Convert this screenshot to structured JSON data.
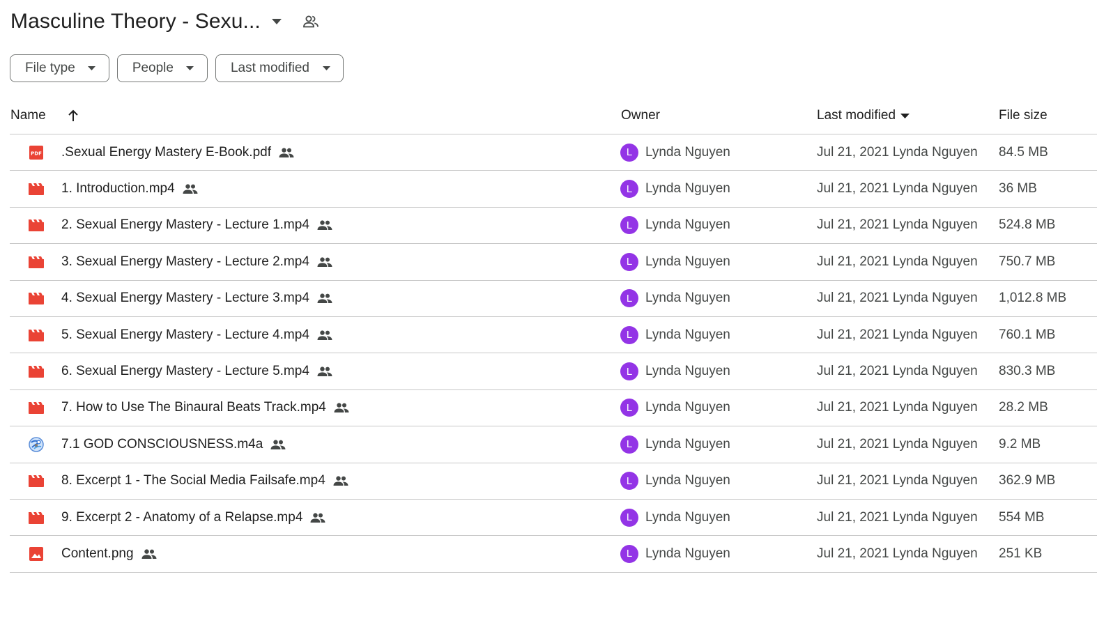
{
  "folder": {
    "title": "Masculine Theory - Sexu..."
  },
  "filters": [
    {
      "label": "File type"
    },
    {
      "label": "People"
    },
    {
      "label": "Last modified"
    }
  ],
  "columns": {
    "name": "Name",
    "owner": "Owner",
    "modified": "Last modified",
    "size": "File size"
  },
  "colors": {
    "file_red": "#ea4335",
    "avatar": "#9334e6",
    "divider": "#c7c7c7"
  },
  "rows": [
    {
      "name": ".Sexual Energy Mastery E-Book.pdf",
      "icon": "pdf-icon",
      "avatar_letter": "L",
      "owner": "Lynda Nguyen",
      "modified": "Jul 21, 2021 Lynda Nguyen",
      "size": "84.5 MB"
    },
    {
      "name": "1. Introduction.mp4",
      "icon": "video-icon",
      "avatar_letter": "L",
      "owner": "Lynda Nguyen",
      "modified": "Jul 21, 2021 Lynda Nguyen",
      "size": "36 MB"
    },
    {
      "name": "2. Sexual Energy Mastery - Lecture 1.mp4",
      "icon": "video-icon",
      "avatar_letter": "L",
      "owner": "Lynda Nguyen",
      "modified": "Jul 21, 2021 Lynda Nguyen",
      "size": "524.8 MB"
    },
    {
      "name": "3. Sexual Energy Mastery - Lecture 2.mp4",
      "icon": "video-icon",
      "avatar_letter": "L",
      "owner": "Lynda Nguyen",
      "modified": "Jul 21, 2021 Lynda Nguyen",
      "size": "750.7 MB"
    },
    {
      "name": "4. Sexual Energy Mastery - Lecture 3.mp4",
      "icon": "video-icon",
      "avatar_letter": "L",
      "owner": "Lynda Nguyen",
      "modified": "Jul 21, 2021 Lynda Nguyen",
      "size": "1,012.8 MB"
    },
    {
      "name": "5. Sexual Energy Mastery - Lecture 4.mp4",
      "icon": "video-icon",
      "avatar_letter": "L",
      "owner": "Lynda Nguyen",
      "modified": "Jul 21, 2021 Lynda Nguyen",
      "size": "760.1 MB"
    },
    {
      "name": "6. Sexual Energy Mastery - Lecture 5.mp4",
      "icon": "video-icon",
      "avatar_letter": "L",
      "owner": "Lynda Nguyen",
      "modified": "Jul 21, 2021 Lynda Nguyen",
      "size": "830.3 MB"
    },
    {
      "name": "7. How to Use The Binaural Beats Track.mp4",
      "icon": "video-icon",
      "avatar_letter": "L",
      "owner": "Lynda Nguyen",
      "modified": "Jul 21, 2021 Lynda Nguyen",
      "size": "28.2 MB"
    },
    {
      "name": "7.1 GOD CONSCIOUSNESS.m4a",
      "icon": "audio-file-icon",
      "avatar_letter": "L",
      "owner": "Lynda Nguyen",
      "modified": "Jul 21, 2021 Lynda Nguyen",
      "size": "9.2 MB"
    },
    {
      "name": "8. Excerpt 1 - The Social Media Failsafe.mp4",
      "icon": "video-icon",
      "avatar_letter": "L",
      "owner": "Lynda Nguyen",
      "modified": "Jul 21, 2021 Lynda Nguyen",
      "size": "362.9 MB"
    },
    {
      "name": "9. Excerpt 2 - Anatomy of a Relapse.mp4",
      "icon": "video-icon",
      "avatar_letter": "L",
      "owner": "Lynda Nguyen",
      "modified": "Jul 21, 2021 Lynda Nguyen",
      "size": "554 MB"
    },
    {
      "name": "Content.png",
      "icon": "image-icon",
      "avatar_letter": "L",
      "owner": "Lynda Nguyen",
      "modified": "Jul 21, 2021 Lynda Nguyen",
      "size": "251 KB"
    }
  ]
}
